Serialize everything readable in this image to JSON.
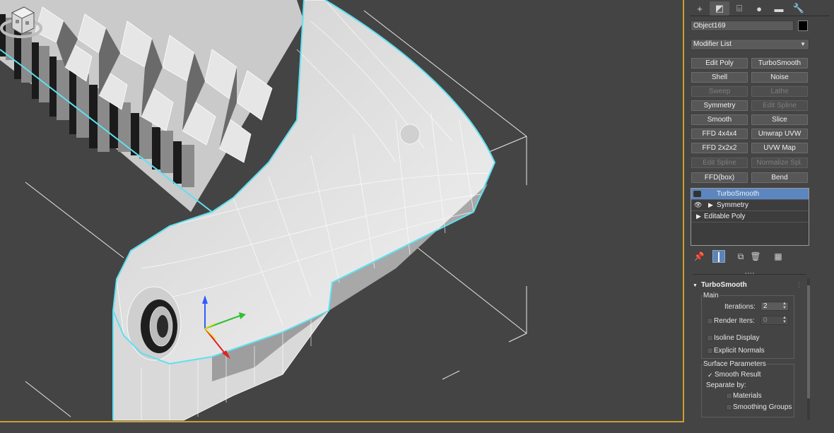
{
  "colors": {
    "background": "#444444",
    "viewport_border": "#c8a030",
    "selection_outline": "#5ee0f0",
    "selected_modifier": "#5b86c0"
  },
  "command_panel": {
    "tabs": [
      {
        "icon": "plus-icon",
        "glyph": "+"
      },
      {
        "icon": "modify-icon",
        "glyph": "◩"
      },
      {
        "icon": "hierarchy-icon",
        "glyph": "⌸"
      },
      {
        "icon": "motion-icon",
        "glyph": "●"
      },
      {
        "icon": "display-icon",
        "glyph": "▬"
      },
      {
        "icon": "utilities-icon",
        "glyph": "🔧"
      }
    ],
    "object_name": "Object169",
    "object_color": "#000000",
    "modifier_list_label": "Modifier List",
    "modifier_buttons": [
      {
        "label": "Edit Poly",
        "enabled": true
      },
      {
        "label": "TurboSmooth",
        "enabled": true
      },
      {
        "label": "Shell",
        "enabled": true
      },
      {
        "label": "Noise",
        "enabled": true
      },
      {
        "label": "Sweep",
        "enabled": false
      },
      {
        "label": "Lathe",
        "enabled": false
      },
      {
        "label": "Symmetry",
        "enabled": true
      },
      {
        "label": "Edit Spline",
        "enabled": false
      },
      {
        "label": "Smooth",
        "enabled": true
      },
      {
        "label": "Slice",
        "enabled": true
      },
      {
        "label": "FFD 4x4x4",
        "enabled": true
      },
      {
        "label": "Unwrap UVW",
        "enabled": true
      },
      {
        "label": "FFD 2x2x2",
        "enabled": true
      },
      {
        "label": "UVW Map",
        "enabled": true
      },
      {
        "label": "Edit Spline",
        "enabled": false
      },
      {
        "label": "Normalize Spl.",
        "enabled": false
      },
      {
        "label": "FFD(box)",
        "enabled": true
      },
      {
        "label": "Bend",
        "enabled": true
      }
    ],
    "stack": [
      {
        "label": "TurboSmooth",
        "selected": true
      },
      {
        "label": "Symmetry",
        "selected": false
      },
      {
        "label": "Editable Poly",
        "selected": false
      }
    ],
    "stack_tools": [
      {
        "icon": "pin-stack-icon",
        "glyph": "📌",
        "active": false
      },
      {
        "icon": "show-end-result-icon",
        "glyph": "┃",
        "active": true
      },
      {
        "icon": "make-unique-icon",
        "glyph": "⧉",
        "active": false
      },
      {
        "icon": "remove-modifier-icon",
        "glyph": "🗑",
        "active": false
      },
      {
        "icon": "configure-modifier-sets-icon",
        "glyph": "▦",
        "active": false
      }
    ],
    "turbosmooth": {
      "title": "TurboSmooth",
      "main_group": "Main",
      "iterations_label": "Iterations:",
      "iterations_value": "2",
      "render_iters_label": "Render Iters:",
      "render_iters_value": "0",
      "render_iters_checked": false,
      "isoline_label": "Isoline Display",
      "isoline_checked": false,
      "explicit_normals_label": "Explicit Normals",
      "explicit_normals_checked": false,
      "surface_group": "Surface Parameters",
      "smooth_result_label": "Smooth Result",
      "smooth_result_checked": true,
      "separate_by_label": "Separate by:",
      "materials_label": "Materials",
      "materials_checked": false,
      "smoothing_groups_label": "Smoothing Groups",
      "smoothing_groups_checked": false
    }
  }
}
